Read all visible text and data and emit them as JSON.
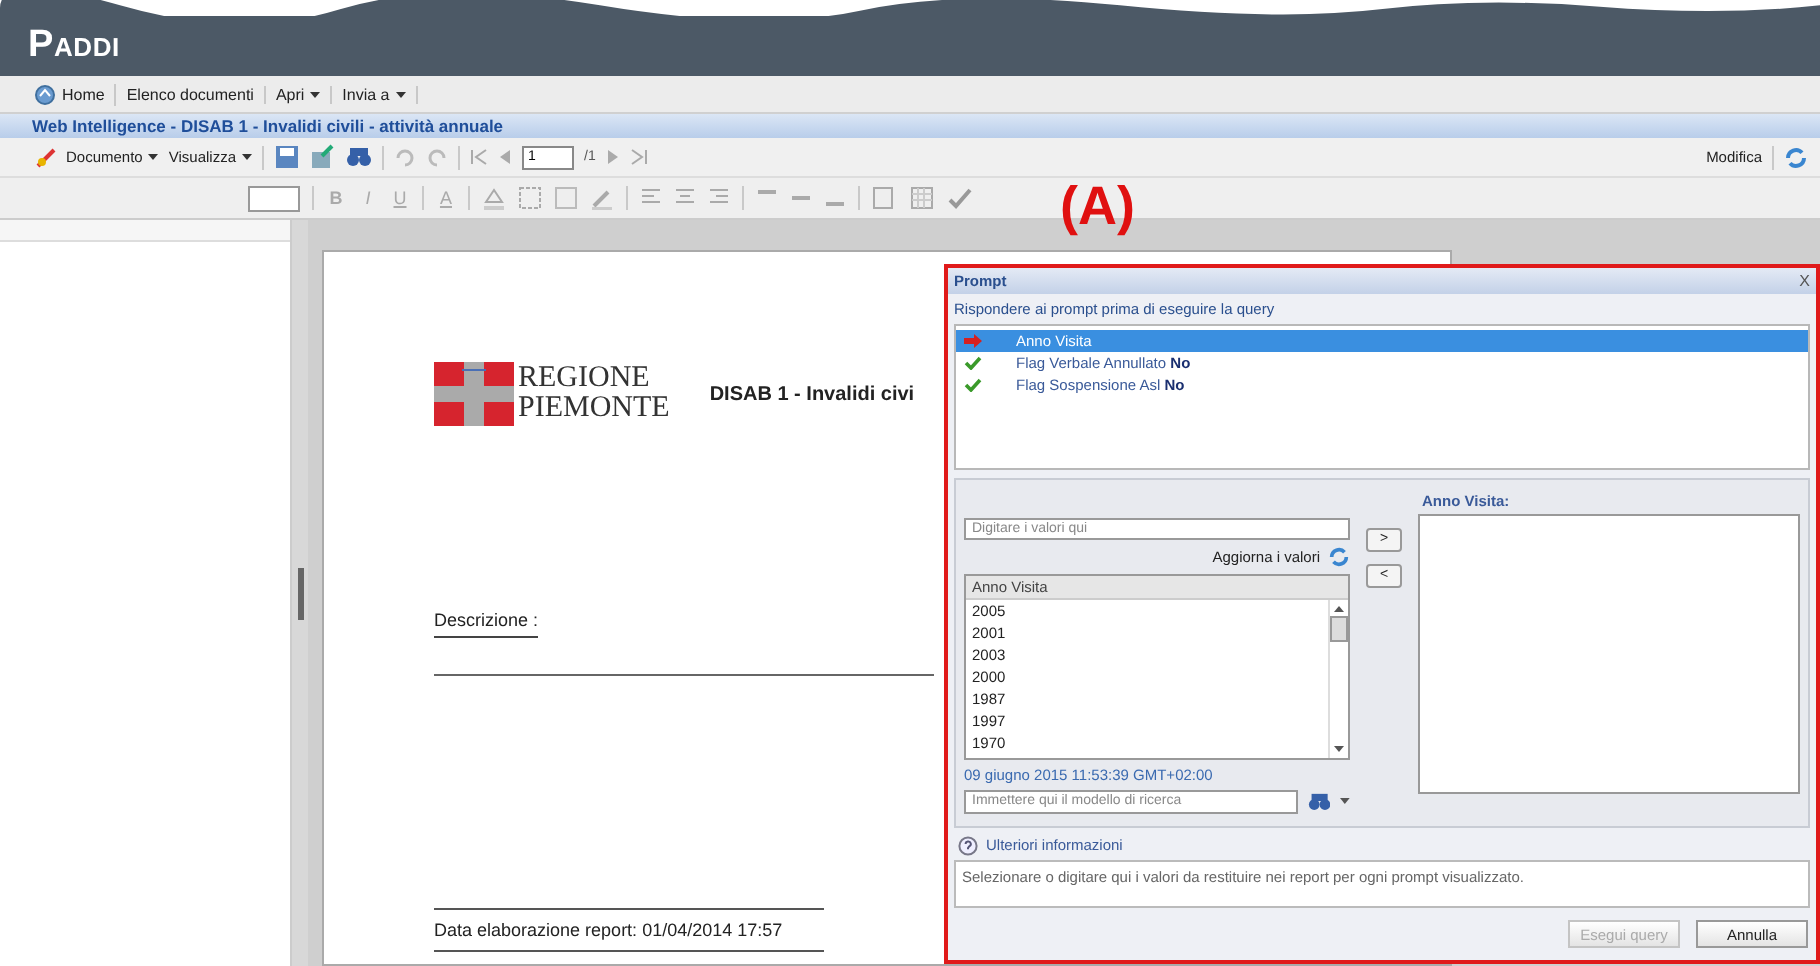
{
  "app": {
    "logo": "PADDI"
  },
  "menu": [
    {
      "label": "Home",
      "kind": "home"
    },
    {
      "label": "Elenco documenti",
      "kind": "plain"
    },
    {
      "label": "Apri",
      "kind": "dropdown"
    },
    {
      "label": "Invia a",
      "kind": "dropdown"
    }
  ],
  "document_title": "Web Intelligence - DISAB 1 - Invalidi civili - attività annuale",
  "toolbar": {
    "menus": [
      "Documento",
      "Visualizza"
    ],
    "page_field": "1",
    "page_total": "/1",
    "mode": "Modifica"
  },
  "format_toolbar": {
    "bold": "B",
    "italic": "I",
    "underline": "U",
    "font_color": "A"
  },
  "callout": "(A)",
  "report": {
    "logo_lines": [
      "REGIONE",
      "PIEMONTE"
    ],
    "title": "DISAB 1 - Invalidi civi",
    "description_label": "Descrizione :",
    "footer": "Data elaborazione report: 01/04/2014 17:57"
  },
  "dialog": {
    "title": "Prompt",
    "close": "X",
    "instruction": "Rispondere ai prompt prima di eseguire la query",
    "prompts": [
      {
        "kind": "current",
        "label": "Anno Visita",
        "selected": true
      },
      {
        "kind": "answered",
        "label": "Flag Verbale Annullato",
        "value": "No",
        "selected": false
      },
      {
        "kind": "answered",
        "label": "Flag Sospensione Asl",
        "value": "No",
        "selected": false
      }
    ],
    "value_input": {
      "placeholder": "Digitare i valori qui"
    },
    "refresh_label": "Aggiorna i valori",
    "add_button": ">",
    "remove_button": "<",
    "values_list": {
      "header": "Anno Visita",
      "items": [
        "2005",
        "2001",
        "2003",
        "2000",
        "1987",
        "1997",
        "1970"
      ]
    },
    "timestamp": "09 giugno 2015 11:53:39 GMT+02:00",
    "search_input": {
      "placeholder": "Immettere qui il modello di ricerca"
    },
    "selected_label": "Anno Visita:",
    "info_link": "Ulteriori informazioni",
    "help_text": "Selezionare o digitare qui i valori da restituire nei report per ogni prompt visualizzato.",
    "buttons": [
      {
        "label": "Esegui query",
        "disabled": true
      },
      {
        "label": "Annulla",
        "disabled": false
      }
    ]
  }
}
